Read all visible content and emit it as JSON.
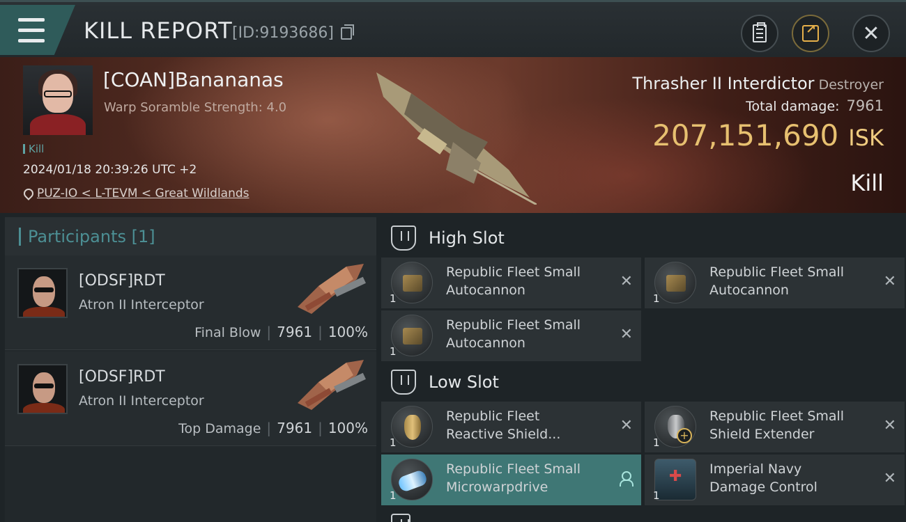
{
  "header": {
    "title": "KILL REPORT",
    "report_id": "[ID:9193686]"
  },
  "victim": {
    "name": "[COAN]Banananas",
    "scramble": "Warp Soramble Strength: 4.0",
    "tag": "Kill",
    "datetime": "2024/01/18 20:39:26 UTC +2",
    "location": "PUZ-IO < L-TEVM < Great Wildlands",
    "ship_name": "Thrasher II Interdictor",
    "ship_class": "Destroyer",
    "total_damage_label": "Total damage:",
    "total_damage": "7961",
    "isk_value": "207,151,690",
    "isk_unit": "ISK",
    "result": "Kill"
  },
  "participants": {
    "title": "Participants [1]",
    "rows": [
      {
        "name": "[ODSF]RDT",
        "ship": "Atron II Interceptor",
        "role": "Final Blow",
        "damage": "7961",
        "percent": "100%"
      },
      {
        "name": "[ODSF]RDT",
        "ship": "Atron II Interceptor",
        "role": "Top Damage",
        "damage": "7961",
        "percent": "100%"
      }
    ]
  },
  "fitting": {
    "high_slot_label": "High Slot",
    "low_slot_label": "Low Slot",
    "high": [
      {
        "line1": "Republic Fleet Small",
        "line2": "Autocannon",
        "qty": "1",
        "icon": "autocannon-icon"
      },
      {
        "line1": "Republic Fleet Small",
        "line2": "Autocannon",
        "qty": "1",
        "icon": "autocannon-icon"
      },
      {
        "line1": "Republic Fleet Small",
        "line2": "Autocannon",
        "qty": "1",
        "icon": "autocannon-icon"
      }
    ],
    "low": [
      {
        "line1": "Republic Fleet",
        "line2": "Reactive Shield...",
        "qty": "1",
        "icon": "reactive-shield-icon"
      },
      {
        "line1": "Republic Fleet Small",
        "line2": "Shield Extender",
        "qty": "1",
        "icon": "shield-extender-icon"
      },
      {
        "line1": "Republic Fleet Small",
        "line2": "Microwarpdrive",
        "qty": "1",
        "icon": "microwarpdrive-icon"
      },
      {
        "line1": "Imperial Navy",
        "line2": "Damage Control",
        "qty": "1",
        "icon": "damage-control-icon"
      }
    ]
  },
  "colors": {
    "accent_teal": "#4c8f94",
    "isk_gold": "#e7c070",
    "active_module": "#3f7775"
  }
}
